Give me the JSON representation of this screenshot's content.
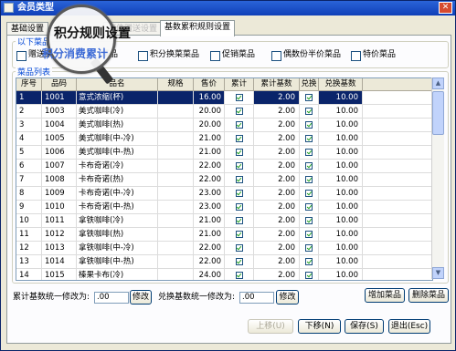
{
  "window": {
    "title": "会员类型"
  },
  "tabs": [
    {
      "label": "基础设置"
    },
    {
      "label": "储值赠送设置"
    },
    {
      "label": "基数累积规则设置"
    }
  ],
  "magnifier": {
    "line1": "积分规则设置",
    "line2": "积分消费累计"
  },
  "options": {
    "legend": "以下菜品",
    "items": [
      {
        "label": "赠送菜品"
      },
      {
        "label": "菜品"
      },
      {
        "label": "积分换菜菜品"
      },
      {
        "label": "促销菜品"
      },
      {
        "label": "偶数份半价菜品"
      },
      {
        "label": "特价菜品"
      }
    ]
  },
  "grid": {
    "legend": "菜品列表",
    "headers": [
      "序号",
      "品码",
      "品名",
      "规格",
      "售价",
      "累计",
      "累计基数",
      "兑换",
      "兑换基数"
    ],
    "rows": [
      {
        "seq": "1",
        "code": "1001",
        "name": "意式浓缩(杯)",
        "spec": "",
        "price": "16.00",
        "acc": true,
        "acc_base": "2.00",
        "exch": true,
        "exch_base": "10.00"
      },
      {
        "seq": "2",
        "code": "1003",
        "name": "美式咖啡(冷)",
        "spec": "",
        "price": "20.00",
        "acc": true,
        "acc_base": "2.00",
        "exch": true,
        "exch_base": "10.00"
      },
      {
        "seq": "3",
        "code": "1004",
        "name": "美式咖啡(热)",
        "spec": "",
        "price": "20.00",
        "acc": true,
        "acc_base": "2.00",
        "exch": true,
        "exch_base": "10.00"
      },
      {
        "seq": "4",
        "code": "1005",
        "name": "美式咖啡(中-冷)",
        "spec": "",
        "price": "21.00",
        "acc": true,
        "acc_base": "2.00",
        "exch": true,
        "exch_base": "10.00"
      },
      {
        "seq": "5",
        "code": "1006",
        "name": "美式咖啡(中-热)",
        "spec": "",
        "price": "21.00",
        "acc": true,
        "acc_base": "2.00",
        "exch": true,
        "exch_base": "10.00"
      },
      {
        "seq": "6",
        "code": "1007",
        "name": "卡布奇诺(冷)",
        "spec": "",
        "price": "22.00",
        "acc": true,
        "acc_base": "2.00",
        "exch": true,
        "exch_base": "10.00"
      },
      {
        "seq": "7",
        "code": "1008",
        "name": "卡布奇诺(热)",
        "spec": "",
        "price": "22.00",
        "acc": true,
        "acc_base": "2.00",
        "exch": true,
        "exch_base": "10.00"
      },
      {
        "seq": "8",
        "code": "1009",
        "name": "卡布奇诺(中-冷)",
        "spec": "",
        "price": "23.00",
        "acc": true,
        "acc_base": "2.00",
        "exch": true,
        "exch_base": "10.00"
      },
      {
        "seq": "9",
        "code": "1010",
        "name": "卡布奇诺(中-热)",
        "spec": "",
        "price": "23.00",
        "acc": true,
        "acc_base": "2.00",
        "exch": true,
        "exch_base": "10.00"
      },
      {
        "seq": "10",
        "code": "1011",
        "name": "拿铁咖啡(冷)",
        "spec": "",
        "price": "21.00",
        "acc": true,
        "acc_base": "2.00",
        "exch": true,
        "exch_base": "10.00"
      },
      {
        "seq": "11",
        "code": "1012",
        "name": "拿铁咖啡(热)",
        "spec": "",
        "price": "21.00",
        "acc": true,
        "acc_base": "2.00",
        "exch": true,
        "exch_base": "10.00"
      },
      {
        "seq": "12",
        "code": "1013",
        "name": "拿铁咖啡(中-冷)",
        "spec": "",
        "price": "22.00",
        "acc": true,
        "acc_base": "2.00",
        "exch": true,
        "exch_base": "10.00"
      },
      {
        "seq": "13",
        "code": "1014",
        "name": "拿铁咖啡(中-热)",
        "spec": "",
        "price": "22.00",
        "acc": true,
        "acc_base": "2.00",
        "exch": true,
        "exch_base": "10.00"
      },
      {
        "seq": "14",
        "code": "1015",
        "name": "榛果卡布(冷)",
        "spec": "",
        "price": "24.00",
        "acc": true,
        "acc_base": "2.00",
        "exch": true,
        "exch_base": "10.00"
      }
    ]
  },
  "bulk": {
    "acc_label": "累计基数统一修改为:",
    "acc_value": ".00",
    "acc_btn": "修改",
    "exch_label": "兑换基数统一修改为:",
    "exch_value": ".00",
    "exch_btn": "修改",
    "add_btn": "增加菜品",
    "del_btn": "删除菜品"
  },
  "footer": {
    "prev": "上移(U)",
    "next": "下移(N)",
    "save": "保存(S)",
    "exit": "退出(Esc)"
  },
  "colors": {
    "selection": "#0a246a",
    "titlebar": "#2a63d8",
    "legend": "#0046d5"
  }
}
